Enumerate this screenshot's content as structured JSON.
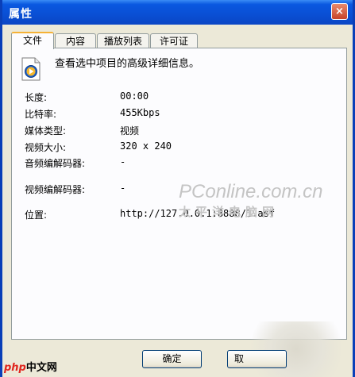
{
  "window": {
    "title": "属性",
    "close_glyph": "×"
  },
  "tabs": [
    {
      "label": "文件"
    },
    {
      "label": "内容"
    },
    {
      "label": "播放列表"
    },
    {
      "label": "许可证"
    }
  ],
  "panel": {
    "file_icon": "media-file-icon",
    "description": "查看选中项目的高级详细信息。",
    "rows": [
      {
        "label": "长度:",
        "value": "00:00"
      },
      {
        "label": "比特率:",
        "value": "455Kbps"
      },
      {
        "label": "媒体类型:",
        "value": "视频"
      },
      {
        "label": "视频大小:",
        "value": "320 x 240"
      },
      {
        "label": "音频编解码器:",
        "value": "-"
      },
      {
        "label": "视频编解码器:",
        "value": "-"
      },
      {
        "label": "位置:",
        "value": "http://127.0.0.1:8888/1.asf"
      }
    ]
  },
  "watermark": {
    "line1": "PConline.com.cn",
    "line2": "太平洋电脑网"
  },
  "buttons": {
    "ok_label": "确定",
    "next_label": "取"
  },
  "logo": {
    "php": "php",
    "cn": "中文网"
  }
}
